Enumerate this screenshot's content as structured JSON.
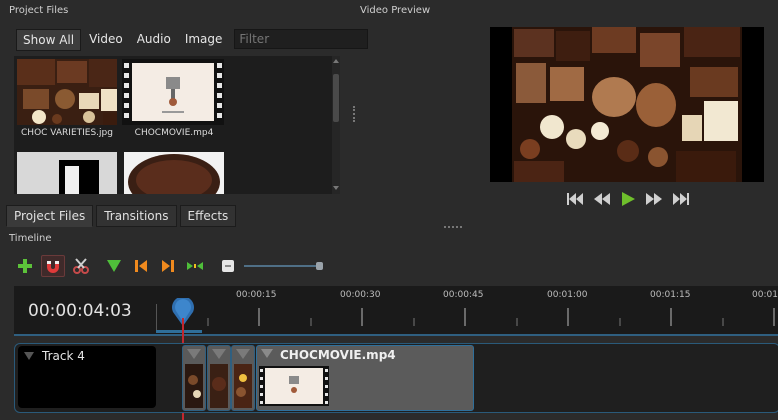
{
  "panels": {
    "project_files_title": "Project Files",
    "video_preview_title": "Video Preview",
    "timeline_title": "Timeline"
  },
  "filters": {
    "show_all": "Show All",
    "video": "Video",
    "audio": "Audio",
    "image": "Image",
    "search_placeholder": "Filter"
  },
  "files": [
    {
      "name": "CHOC VARIETIES.jpg"
    },
    {
      "name": "CHOCMOVIE.mp4"
    }
  ],
  "bottom_tabs": [
    "Project Files",
    "Transitions",
    "Effects"
  ],
  "toolbar_icons": [
    "add-track-icon",
    "snap-magnet-icon",
    "razor-icon",
    "add-marker-icon",
    "previous-marker-icon",
    "next-marker-icon",
    "center-playhead-icon",
    "zoom-out-icon"
  ],
  "timeline": {
    "timecode": "00:00:04:03",
    "ticks": [
      "00:00:15",
      "00:00:30",
      "00:00:45",
      "00:01:00",
      "00:01:15",
      "00:01:"
    ]
  },
  "track": {
    "name": "Track 4",
    "clip_title": "CHOCMOVIE.mp4"
  },
  "playback_icons": [
    "jump-start-icon",
    "rewind-icon",
    "play-icon",
    "fast-forward-icon",
    "jump-end-icon"
  ],
  "colors": {
    "background": "#2b2b2b",
    "accent_blue": "#2f6f9a",
    "play_green": "#6fbf2c",
    "playhead_red": "#c3272e"
  }
}
